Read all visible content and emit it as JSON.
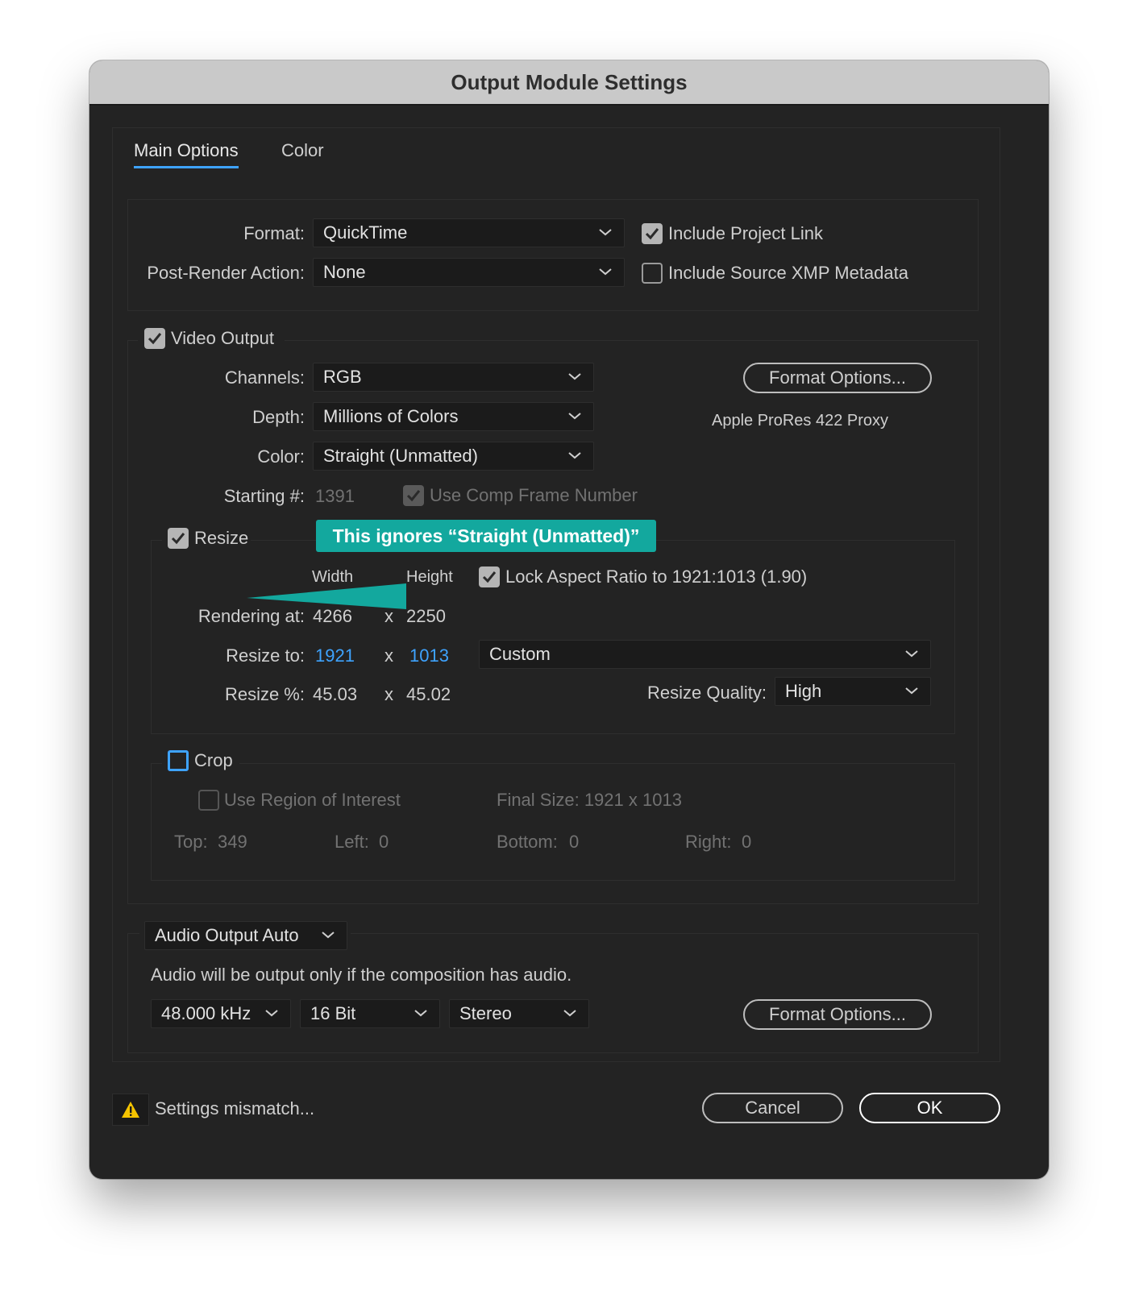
{
  "window": {
    "title": "Output Module Settings"
  },
  "tabs": [
    {
      "label": "Main Options",
      "active": true
    },
    {
      "label": "Color",
      "active": false
    }
  ],
  "format": {
    "format_label": "Format:",
    "format_value": "QuickTime",
    "post_render_label": "Post-Render Action:",
    "post_render_value": "None",
    "include_project_link": {
      "label": "Include Project Link",
      "checked": true
    },
    "include_xmp": {
      "label": "Include Source XMP Metadata",
      "checked": false
    }
  },
  "video": {
    "section_label": "Video Output",
    "checked": true,
    "channels_label": "Channels:",
    "channels_value": "RGB",
    "depth_label": "Depth:",
    "depth_value": "Millions of Colors",
    "color_label": "Color:",
    "color_value": "Straight (Unmatted)",
    "starting_label": "Starting #:",
    "starting_value": "1391",
    "use_comp_frame": {
      "label": "Use Comp Frame Number",
      "checked": true,
      "enabled": false
    },
    "format_options_button": "Format Options...",
    "codec_text": "Apple ProRes 422 Proxy"
  },
  "annotation": {
    "text": "This ignores “Straight (Unmatted)”",
    "color": "#13a89e"
  },
  "resize": {
    "section_label": "Resize",
    "checked": true,
    "width_header": "Width",
    "height_header": "Height",
    "lock_aspect": {
      "label": "Lock Aspect Ratio to 1921:1013 (1.90)",
      "checked": true
    },
    "rendering_label": "Rendering at:",
    "rendering_w": "4266",
    "rendering_h": "2250",
    "resize_to_label": "Resize to:",
    "resize_to_w": "1921",
    "resize_to_h": "1013",
    "preset_value": "Custom",
    "resize_pct_label": "Resize %:",
    "resize_pct_w": "45.03",
    "resize_pct_h": "45.02",
    "x_sep": "x",
    "quality_label": "Resize Quality:",
    "quality_value": "High"
  },
  "crop": {
    "section_label": "Crop",
    "checked": false,
    "use_roi": {
      "label": "Use Region of Interest",
      "checked": false
    },
    "final_size": "Final Size: 1921 x 1013",
    "top_label": "Top:",
    "top_value": "349",
    "left_label": "Left:",
    "left_value": "0",
    "bottom_label": "Bottom:",
    "bottom_value": "0",
    "right_label": "Right:",
    "right_value": "0"
  },
  "audio": {
    "mode_value": "Audio Output Auto",
    "note": "Audio will be output only if the composition has audio.",
    "rate_value": "48.000 kHz",
    "bits_value": "16 Bit",
    "channels_value": "Stereo",
    "format_options_button": "Format Options..."
  },
  "footer": {
    "warning_text": "Settings mismatch...",
    "cancel_label": "Cancel",
    "ok_label": "OK",
    "accent": "#3ea3ff",
    "warning_color": "#f5c400"
  }
}
